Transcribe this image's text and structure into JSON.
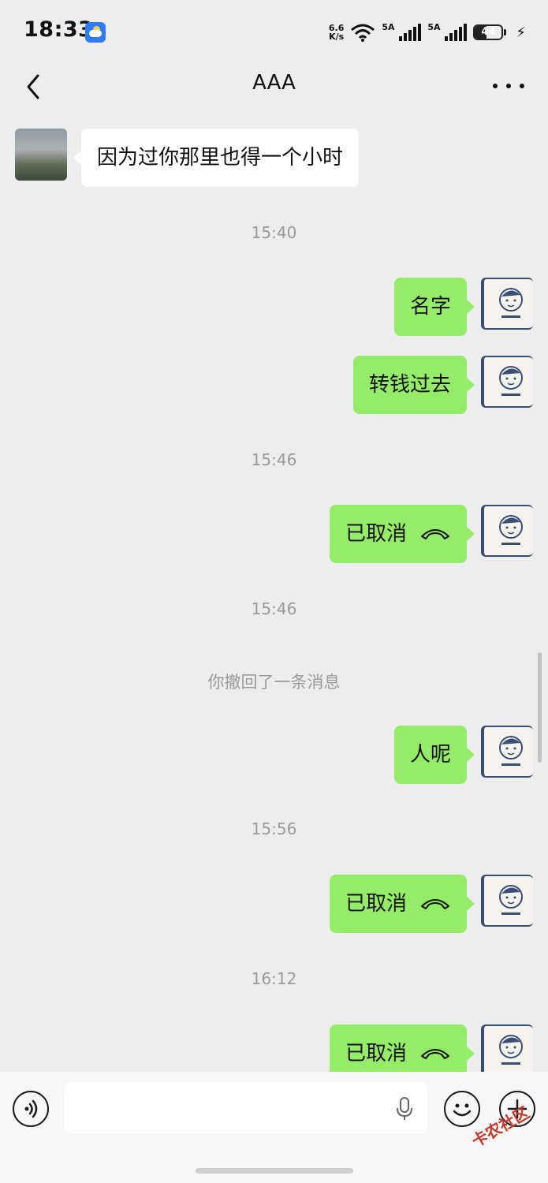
{
  "status_bar": {
    "time": "18:33",
    "net_speed_top": "6.6",
    "net_speed_bottom": "K/s",
    "sim1_label": "5A",
    "sim2_label": "5A",
    "battery_level": "44",
    "battery_fraction": 0.44
  },
  "navbar": {
    "title": "AAA"
  },
  "messages": [
    {
      "type": "text",
      "side": "other",
      "text": "因为过你那里也得一个小时"
    },
    {
      "type": "timestamp",
      "text": "15:40"
    },
    {
      "type": "text",
      "side": "me",
      "text": "名字"
    },
    {
      "type": "text",
      "side": "me",
      "text": "转钱过去"
    },
    {
      "type": "timestamp",
      "text": "15:46"
    },
    {
      "type": "call",
      "side": "me",
      "text": "已取消"
    },
    {
      "type": "timestamp",
      "text": "15:46"
    },
    {
      "type": "notice",
      "text": "你撤回了一条消息"
    },
    {
      "type": "text",
      "side": "me",
      "text": "人呢"
    },
    {
      "type": "timestamp",
      "text": "15:56"
    },
    {
      "type": "call",
      "side": "me",
      "text": "已取消"
    },
    {
      "type": "timestamp",
      "text": "16:12"
    },
    {
      "type": "call",
      "side": "me",
      "text": "已取消"
    }
  ],
  "input_bar": {
    "value": "",
    "placeholder": ""
  },
  "watermark": "卡农社区",
  "colors": {
    "background": "#ededed",
    "my_bubble": "#95ec69",
    "other_bubble": "#ffffff",
    "timestamp_text": "#9a9a9a"
  }
}
